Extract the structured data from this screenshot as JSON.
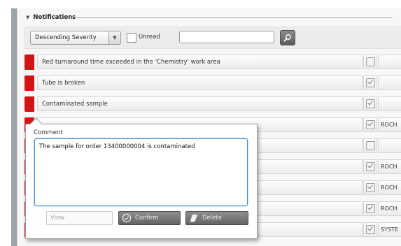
{
  "panel": {
    "title": "Notifications"
  },
  "toolbar": {
    "sort_value": "Descending Severity",
    "unread_label": "Unread",
    "search_value": ""
  },
  "rows": [
    {
      "text": "Red turnaround time exceeded in the 'Chemistry' work area",
      "acknowledged": false,
      "source": ""
    },
    {
      "text": "Tube is broken",
      "acknowledged": true,
      "source": ""
    },
    {
      "text": "Contaminated sample",
      "acknowledged": true,
      "source": ""
    },
    {
      "text": "",
      "acknowledged": true,
      "source": "ROCH"
    },
    {
      "text": "",
      "acknowledged": false,
      "source": ""
    },
    {
      "text": "",
      "acknowledged": true,
      "source": "ROCH"
    },
    {
      "text": "",
      "acknowledged": true,
      "source": "ROCH"
    },
    {
      "text": "",
      "acknowledged": true,
      "source": "ROCH"
    },
    {
      "text": "",
      "acknowledged": true,
      "source": "SYSTE"
    }
  ],
  "popup": {
    "comment_label": "Comment",
    "comment_value": "The sample for order 13400000004 is contaminated",
    "view_label": "View",
    "confirm_label": "Confirm",
    "delete_label": "Delete"
  },
  "colors": {
    "severity_red": "#d21414",
    "focus_blue": "#3f86d1"
  },
  "icons": {
    "collapse": "triangle-down-icon",
    "dropdown": "chevron-down-icon",
    "search": "magnifier-icon",
    "confirm": "check-circle-icon",
    "delete": "eraser-icon"
  }
}
